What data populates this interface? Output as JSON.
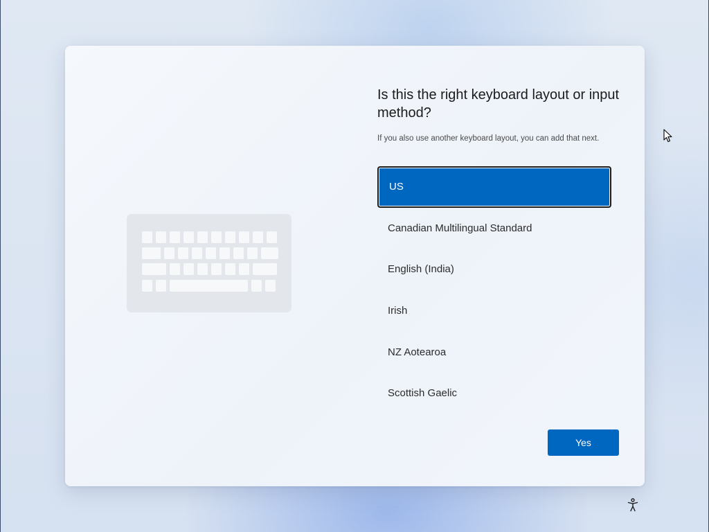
{
  "screen": {
    "question": "Is this the right keyboard layout or input method?",
    "subtitle": "If you also use another keyboard layout, you can add that next."
  },
  "illustration": {
    "icon": "keyboard-icon"
  },
  "layouts": {
    "items": [
      {
        "label": "US",
        "selected": true
      },
      {
        "label": "Canadian Multilingual Standard",
        "selected": false
      },
      {
        "label": "English (India)",
        "selected": false
      },
      {
        "label": "Irish",
        "selected": false
      },
      {
        "label": "NZ Aotearoa",
        "selected": false
      },
      {
        "label": "Scottish Gaelic",
        "selected": false
      }
    ]
  },
  "actions": {
    "yes_label": "Yes"
  },
  "icons": {
    "cursor": "mouse-pointer-icon",
    "accessibility": "accessibility-icon"
  },
  "colors": {
    "accent": "#0067c0",
    "background": "#dbe5f2",
    "dialog": "#f2f6fb",
    "text": "#1b1b1b"
  }
}
